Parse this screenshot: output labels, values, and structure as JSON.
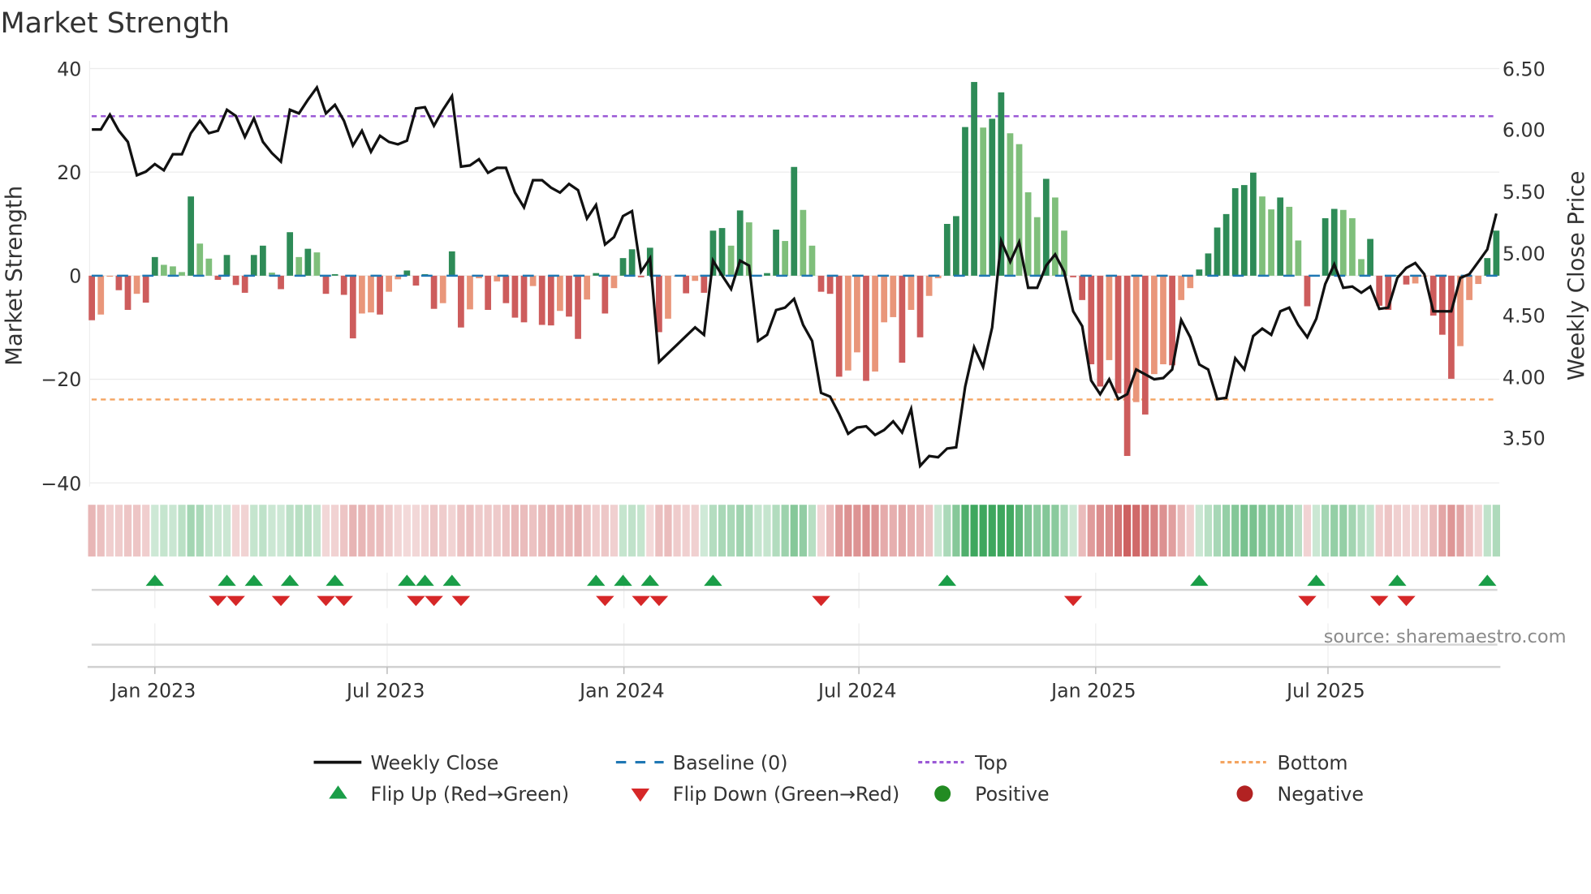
{
  "chart_data": {
    "type": "bar",
    "title": "Market Strength",
    "ylabel": "Market Strength",
    "y2label": "Weekly Close Price",
    "ylim": [
      -40,
      40
    ],
    "y2lim": [
      3.5,
      6.5
    ],
    "grid": true,
    "legend_placement": "bottom-center",
    "source": "source: sharemaestro.com",
    "y_ticks": [
      "40",
      "20",
      "0",
      "−20",
      "−40"
    ],
    "y_tick_values": [
      40,
      20,
      0,
      -20,
      -40
    ],
    "y2_ticks": [
      "6.50",
      "6.00",
      "5.50",
      "5.00",
      "4.50",
      "4.00",
      "3.50"
    ],
    "y2_tick_values": [
      6.5,
      6.0,
      5.5,
      5.0,
      4.5,
      4.0,
      3.5
    ],
    "x_ticks": [
      "Jan 2023",
      "Jul 2023",
      "Jan 2024",
      "Jul 2024",
      "Jan 2025",
      "Jul 2025"
    ],
    "x_tick_week_index": [
      7.0,
      32.8,
      59.1,
      85.2,
      111.5,
      137.3
    ],
    "top_level": 30.8,
    "bottom_level": -23.9,
    "colors": {
      "green_strong": "#2e8b57",
      "green_soft": "#7fbf7b",
      "red_strong": "#cd5c5c",
      "red_soft": "#e9967a",
      "baseline": "#1f77b4",
      "top": "#9b59d6",
      "bottom": "#f4a460",
      "line": "#111111",
      "flip_up": "#1a9e48",
      "flip_down": "#d62728",
      "positive": "#228b22",
      "negative": "#b22222"
    },
    "strength": [
      -8.6,
      -7.5,
      -0.2,
      -2.8,
      -6.6,
      -3.5,
      -5.2,
      3.6,
      2.1,
      1.8,
      0.7,
      15.3,
      6.2,
      3.3,
      -0.8,
      4.0,
      -1.8,
      -3.3,
      4.0,
      5.8,
      0.6,
      -2.6,
      8.4,
      3.6,
      5.2,
      4.5,
      -3.5,
      0.3,
      -3.7,
      -12.1,
      -7.3,
      -7.1,
      -7.5,
      -3.1,
      -0.7,
      1.0,
      -1.9,
      0.3,
      -6.4,
      -5.3,
      4.7,
      -10.0,
      -6.5,
      -0.5,
      -6.6,
      -1.1,
      -5.3,
      -8.1,
      -9.0,
      -2.0,
      -9.5,
      -9.6,
      -6.8,
      -7.9,
      -12.2,
      -4.6,
      0.5,
      -7.3,
      -2.4,
      3.4,
      5.1,
      -0.3,
      5.4,
      -10.9,
      -8.3,
      -0.1,
      -3.4,
      -1.0,
      -3.3,
      8.7,
      9.2,
      5.8,
      12.6,
      10.3,
      0.1,
      0.5,
      8.9,
      6.7,
      21.0,
      12.7,
      5.8,
      -3.1,
      -3.5,
      -19.5,
      -18.3,
      -14.8,
      -20.3,
      -18.5,
      -9.0,
      -8.0,
      -16.8,
      -6.6,
      -11.9,
      -3.9,
      -0.5,
      10.0,
      11.5,
      28.7,
      37.4,
      28.6,
      30.3,
      35.4,
      27.5,
      25.4,
      16.1,
      11.3,
      18.7,
      15.1,
      8.7,
      -0.3,
      -4.7,
      -17.1,
      -21.4,
      -16.3,
      -22.7,
      -34.8,
      -24.4,
      -26.8,
      -19.0,
      -17.1,
      -17.3,
      -4.7,
      -2.4,
      1.2,
      4.3,
      9.3,
      11.9,
      16.9,
      17.5,
      19.9,
      15.3,
      12.8,
      15.1,
      13.3,
      6.8,
      -5.9,
      0.1,
      11.1,
      12.9,
      12.7,
      11.1,
      3.2,
      7.1,
      -5.8,
      -6.6,
      0.1,
      -1.7,
      -1.5,
      -0.1,
      -7.7,
      -11.4,
      -19.9,
      -13.6,
      -4.7,
      -1.6,
      3.4,
      8.7
    ],
    "weekly_close": [
      6.01,
      6.01,
      6.13,
      6.0,
      5.91,
      5.64,
      5.67,
      5.73,
      5.68,
      5.81,
      5.81,
      5.98,
      6.08,
      5.98,
      6.0,
      6.17,
      6.12,
      5.95,
      6.1,
      5.91,
      5.82,
      5.75,
      6.17,
      6.14,
      6.25,
      6.35,
      6.14,
      6.21,
      6.08,
      5.88,
      6.0,
      5.83,
      5.96,
      5.91,
      5.89,
      5.92,
      6.18,
      6.19,
      6.04,
      6.17,
      6.28,
      5.71,
      5.72,
      5.77,
      5.66,
      5.7,
      5.7,
      5.5,
      5.38,
      5.6,
      5.6,
      5.54,
      5.5,
      5.57,
      5.52,
      5.29,
      5.4,
      5.08,
      5.14,
      5.31,
      5.35,
      4.86,
      4.97,
      4.13,
      4.2,
      4.27,
      4.34,
      4.41,
      4.35,
      4.95,
      4.83,
      4.72,
      4.95,
      4.91,
      4.3,
      4.35,
      4.55,
      4.57,
      4.64,
      4.43,
      4.3,
      3.88,
      3.85,
      3.71,
      3.55,
      3.6,
      3.61,
      3.54,
      3.58,
      3.65,
      3.56,
      3.75,
      3.29,
      3.37,
      3.36,
      3.43,
      3.44,
      3.93,
      4.25,
      4.09,
      4.41,
      5.11,
      4.94,
      5.1,
      4.73,
      4.73,
      4.91,
      5.0,
      4.86,
      4.54,
      4.42,
      3.98,
      3.87,
      3.99,
      3.83,
      3.87,
      4.07,
      4.03,
      3.99,
      4.0,
      4.07,
      4.47,
      4.33,
      4.11,
      4.07,
      3.83,
      3.84,
      4.16,
      4.07,
      4.34,
      4.4,
      4.35,
      4.54,
      4.57,
      4.43,
      4.33,
      4.48,
      4.76,
      4.92,
      4.73,
      4.74,
      4.69,
      4.74,
      4.56,
      4.57,
      4.81,
      4.89,
      4.93,
      4.84,
      4.54,
      4.54,
      4.54,
      4.81,
      4.84,
      4.94,
      5.04,
      5.33
    ]
  },
  "legend": {
    "weekly_close": "Weekly Close",
    "baseline": "Baseline (0)",
    "top": "Top",
    "bottom": "Bottom",
    "flip_up": "Flip Up (Red→Green)",
    "flip_down": "Flip Down (Green→Red)",
    "positive": "Positive",
    "negative": "Negative"
  }
}
